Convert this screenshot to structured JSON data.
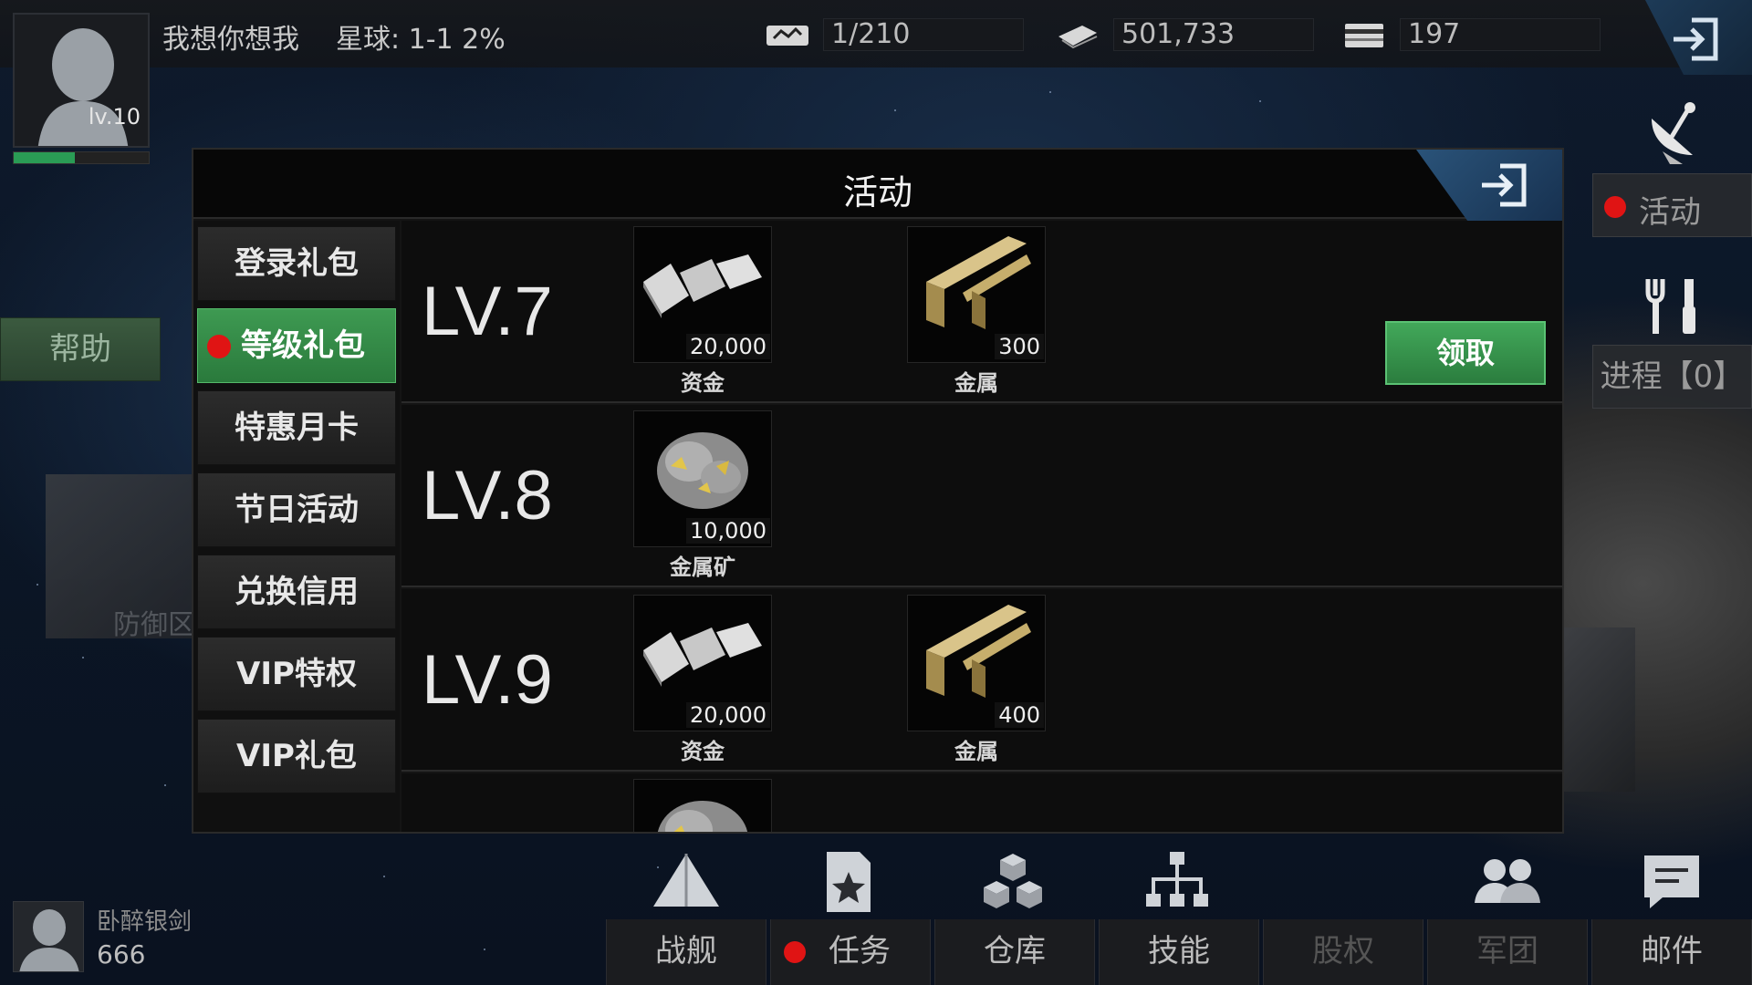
{
  "player": {
    "name": "我想你想我",
    "level_label": "lv.10",
    "xp_fraction": 0.45
  },
  "planet": {
    "label": "星球: 1-1  2%"
  },
  "resources": [
    {
      "icon": "ship-count-icon",
      "value": "1/210"
    },
    {
      "icon": "cash-icon",
      "value": "501,733"
    },
    {
      "icon": "card-icon",
      "value": "197"
    }
  ],
  "sidebar_right": {
    "activity_label": "活动",
    "progress_label": "进程【0】"
  },
  "help_label": "帮助",
  "defense_label": "防御区",
  "modal": {
    "title": "活动",
    "tabs": [
      {
        "label": "登录礼包",
        "active": false,
        "alert": false
      },
      {
        "label": "等级礼包",
        "active": true,
        "alert": true
      },
      {
        "label": "特惠月卡",
        "active": false,
        "alert": false
      },
      {
        "label": "节日活动",
        "active": false,
        "alert": false
      },
      {
        "label": "兑换信用",
        "active": false,
        "alert": false
      },
      {
        "label": "VIP特权",
        "active": false,
        "alert": false
      },
      {
        "label": "VIP礼包",
        "active": false,
        "alert": false
      }
    ],
    "rewards": [
      {
        "level": "LV.7",
        "items": [
          {
            "name": "资金",
            "qty": "20,000",
            "icon": "cash-bundle-icon"
          },
          {
            "name": "金属",
            "qty": "300",
            "icon": "metal-beam-icon"
          }
        ],
        "claim_label": "领取"
      },
      {
        "level": "LV.8",
        "items": [
          {
            "name": "金属矿",
            "qty": "10,000",
            "icon": "ore-icon"
          }
        ]
      },
      {
        "level": "LV.9",
        "items": [
          {
            "name": "资金",
            "qty": "20,000",
            "icon": "cash-bundle-icon"
          },
          {
            "name": "金属",
            "qty": "400",
            "icon": "metal-beam-icon"
          }
        ]
      },
      {
        "level": "",
        "items": [
          {
            "name": "",
            "qty": "",
            "icon": "ore-icon"
          }
        ]
      }
    ]
  },
  "friend": {
    "name": "卧醉银剑",
    "score": "666"
  },
  "bottom_nav": [
    {
      "label": "战舰",
      "icon": "warship-icon",
      "enabled": true,
      "alert": false
    },
    {
      "label": "任务",
      "icon": "mission-icon",
      "enabled": true,
      "alert": true
    },
    {
      "label": "仓库",
      "icon": "warehouse-icon",
      "enabled": true,
      "alert": false
    },
    {
      "label": "技能",
      "icon": "skill-tree-icon",
      "enabled": true,
      "alert": false
    },
    {
      "label": "股权",
      "icon": "",
      "enabled": false,
      "alert": false
    },
    {
      "label": "军团",
      "icon": "legion-icon",
      "enabled": false,
      "alert": false
    },
    {
      "label": "邮件",
      "icon": "mail-icon",
      "enabled": true,
      "alert": false
    }
  ]
}
